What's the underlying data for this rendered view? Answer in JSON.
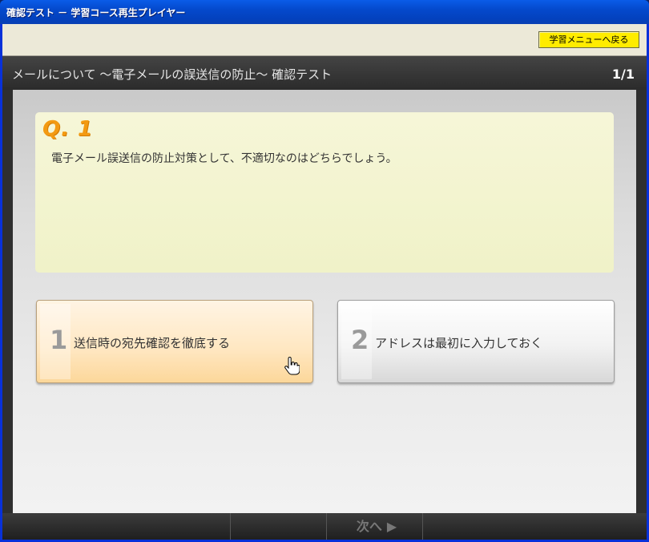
{
  "window": {
    "title": "確認テスト － 学習コース再生プレイヤー"
  },
  "toolbar": {
    "menu_button": "学習メニューへ戻る"
  },
  "header": {
    "lesson_title": "メールについて ～電子メールの誤送信の防止～ 確認テスト",
    "page_count": "1/1"
  },
  "question": {
    "label": "Q. 1",
    "text": "電子メール誤送信の防止対策として、不適切なのはどちらでしょう。"
  },
  "choices": [
    {
      "number": "1",
      "text": "送信時の宛先確認を徹底する"
    },
    {
      "number": "2",
      "text": "アドレスは最初に入力しておく"
    }
  ],
  "footer": {
    "next_label": "次へ",
    "next_arrow": "▶"
  },
  "colors": {
    "accent": "#f39a12",
    "menu_button": "#ffec00",
    "titlebar": "#0449cc"
  }
}
